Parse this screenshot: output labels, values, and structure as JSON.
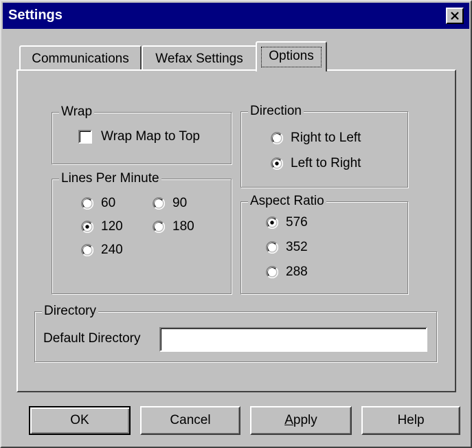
{
  "window": {
    "title": "Settings"
  },
  "tabs": [
    {
      "label": "Communications"
    },
    {
      "label": "Wefax Settings"
    },
    {
      "label": "Options",
      "active": true
    }
  ],
  "wrap": {
    "legend": "Wrap",
    "checkbox_label": "Wrap Map to Top",
    "checked": false
  },
  "direction": {
    "legend": "Direction",
    "options": [
      {
        "label": "Right to Left",
        "selected": false
      },
      {
        "label": "Left to Right",
        "selected": true
      }
    ]
  },
  "lines_per_minute": {
    "legend": "Lines Per Minute",
    "options": [
      {
        "label": "60",
        "selected": false
      },
      {
        "label": "90",
        "selected": false
      },
      {
        "label": "120",
        "selected": true
      },
      {
        "label": "180",
        "selected": false
      },
      {
        "label": "240",
        "selected": false
      }
    ]
  },
  "aspect_ratio": {
    "legend": "Aspect Ratio",
    "options": [
      {
        "label": "576",
        "selected": true
      },
      {
        "label": "352",
        "selected": false
      },
      {
        "label": "288",
        "selected": false
      }
    ]
  },
  "directory": {
    "legend": "Directory",
    "field_label": "Default Directory",
    "value": ""
  },
  "buttons": {
    "ok": "OK",
    "cancel": "Cancel",
    "apply_prefix": "A",
    "apply_rest": "pply",
    "help": "Help"
  },
  "icons": {
    "close": "close-icon",
    "radio": "radio-icon",
    "checkbox": "checkbox-icon"
  }
}
